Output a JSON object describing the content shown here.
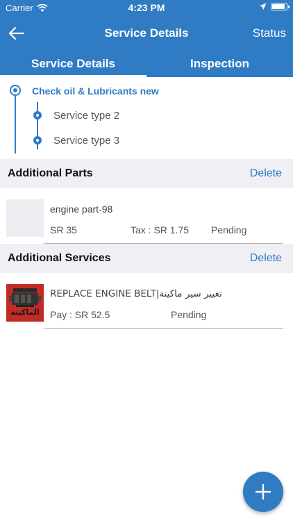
{
  "status_bar": {
    "carrier": "Carrier",
    "time": "4:23 PM",
    "battery_level": 0.9
  },
  "nav": {
    "title": "Service Details",
    "right_action": "Status",
    "back_icon": "arrow-left-icon"
  },
  "tabs": [
    {
      "label": "Service Details",
      "active": true
    },
    {
      "label": "Inspection",
      "active": false
    }
  ],
  "timeline": {
    "main": "Check oil & Lubricants new",
    "items": [
      "Service type 2",
      "Service type 3"
    ]
  },
  "additional_parts": {
    "title": "Additional Parts",
    "action": "Delete",
    "items": [
      {
        "name": "engine part-98",
        "price": "SR 35",
        "tax": "Tax : SR 1.75",
        "status": "Pending"
      }
    ]
  },
  "additional_services": {
    "title": "Additional Services",
    "action": "Delete",
    "items": [
      {
        "name": "REPLACE ENGINE BELT|تغيير سير ماكينة",
        "pay": "Pay : SR 52.5",
        "status": "Pending",
        "thumb_label": "الماكينة"
      }
    ]
  },
  "fab": {
    "icon": "plus-icon"
  },
  "colors": {
    "accent": "#2f7bc4",
    "section_bg": "#efeff4"
  }
}
